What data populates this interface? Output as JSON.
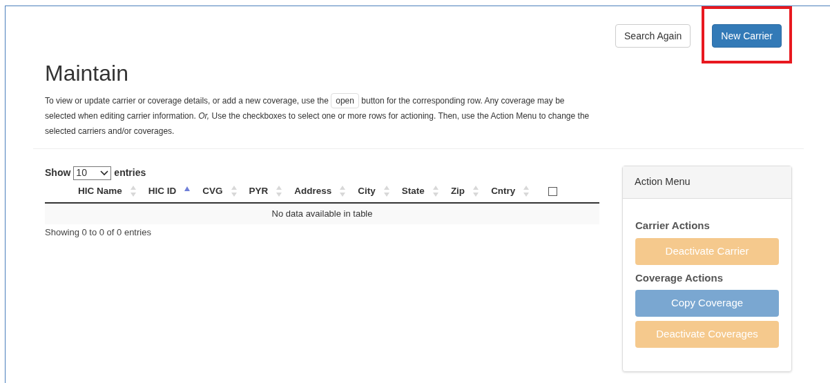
{
  "header_buttons": [
    {
      "label": "Search Again",
      "kind": "default",
      "highlighted": false
    },
    {
      "label": "New Carrier",
      "kind": "primary",
      "highlighted": true
    }
  ],
  "title": "Maintain",
  "description": {
    "before": "To view or update carrier or coverage details, or add a new coverage, use the",
    "chip": "open",
    "after": "button for the corresponding row. Any coverage may be selected when editing carrier information. *Or,* Use the checkboxes to select one or more rows for actioning. Then, use the Action Menu to change the selected carriers and/or coverages."
  },
  "length_menu": {
    "before": "Show",
    "value": "10",
    "after": "entries"
  },
  "table": {
    "columns": [
      {
        "label": "HIC Name",
        "sorted": false
      },
      {
        "label": "HIC ID",
        "sorted": true
      },
      {
        "label": "CVG",
        "sorted": false
      },
      {
        "label": "PYR",
        "sorted": false
      },
      {
        "label": "Address",
        "sorted": false
      },
      {
        "label": "City",
        "sorted": false
      },
      {
        "label": "State",
        "sorted": false
      },
      {
        "label": "Zip",
        "sorted": false
      },
      {
        "label": "Cntry",
        "sorted": false
      }
    ],
    "select_all_checked": false,
    "empty_message": "No data available in table",
    "info": "Showing 0 to 0 of 0 entries"
  },
  "action_menu": {
    "title": "Action Menu",
    "sections": [
      {
        "heading": "Carrier Actions",
        "buttons": [
          {
            "label": "Deactivate Carrier",
            "kind": "warning",
            "disabled": true
          }
        ]
      },
      {
        "heading": "Coverage Actions",
        "buttons": [
          {
            "label": "Copy Coverage",
            "kind": "primary",
            "disabled": true
          },
          {
            "label": "Deactivate Coverages",
            "kind": "warning",
            "disabled": true
          }
        ]
      }
    ]
  }
}
